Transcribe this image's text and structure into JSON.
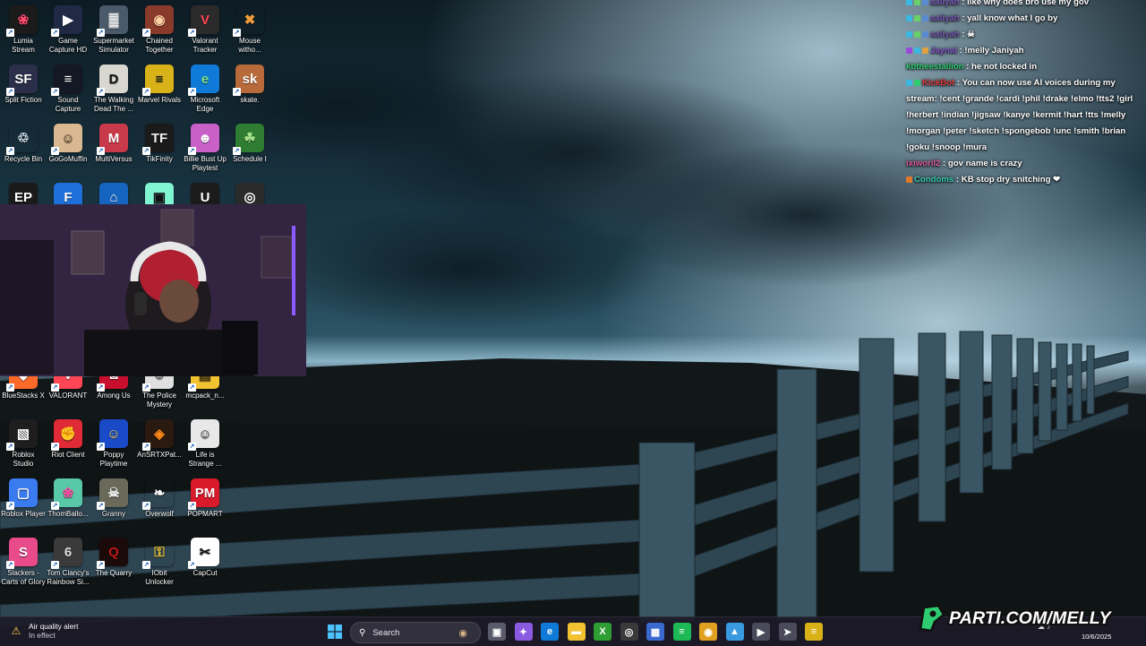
{
  "desktop_icons": [
    {
      "label": "Lumia\nStream",
      "icon": "lumia-icon",
      "color": "#1b1b1b",
      "fg": "#ff4a6e",
      "glyph": "❀"
    },
    {
      "label": "Game\nCapture HD",
      "icon": "game-capture-icon",
      "color": "#202a44",
      "fg": "#ffffff",
      "glyph": "▶"
    },
    {
      "label": "Supermarket\nSimulator",
      "icon": "supermarket-icon",
      "color": "#4a5a6a",
      "fg": "#ffffff",
      "glyph": "▓"
    },
    {
      "label": "Chained\nTogether",
      "icon": "chained-icon",
      "color": "#8a3a2a",
      "fg": "#ffd0a0",
      "glyph": "◉"
    },
    {
      "label": "Valorant\nTracker",
      "icon": "valorant-tracker-icon",
      "color": "#2a2a2a",
      "fg": "#ff4655",
      "glyph": "V"
    },
    {
      "label": "Mouse\nwitho...",
      "icon": "mouse-without-borders-icon",
      "color": "transparent",
      "fg": "#f39c3a",
      "glyph": "✖"
    },
    {
      "label": "Split Fiction",
      "icon": "split-fiction-icon",
      "color": "#2b2f4a",
      "fg": "#ffffff",
      "glyph": "SF"
    },
    {
      "label": "Sound\nCapture",
      "icon": "sound-capture-icon",
      "color": "#141824",
      "fg": "#ffffff",
      "glyph": "≡"
    },
    {
      "label": "The Walking\nDead The ...",
      "icon": "walking-dead-icon",
      "color": "#d8d8d0",
      "fg": "#111111",
      "glyph": "D"
    },
    {
      "label": "Marvel Rivals",
      "icon": "marvel-rivals-icon",
      "color": "#d9b21a",
      "fg": "#1a1a1a",
      "glyph": "≡"
    },
    {
      "label": "Microsoft\nEdge",
      "icon": "edge-icon",
      "color": "#0f7ad8",
      "fg": "#7ee08a",
      "glyph": "e"
    },
    {
      "label": "skate.",
      "icon": "skate-icon",
      "color": "#b96a3a",
      "fg": "#ffffff",
      "glyph": "sk"
    },
    {
      "label": "Recycle Bin",
      "icon": "recycle-bin-icon",
      "color": "transparent",
      "fg": "#d9e6f2",
      "glyph": "♲"
    },
    {
      "label": "GoGoMuffin",
      "icon": "gogomuffin-icon",
      "color": "#d8b890",
      "fg": "#5a3a2a",
      "glyph": "☺"
    },
    {
      "label": "MultiVersus",
      "icon": "multiversus-icon",
      "color": "#c83a4a",
      "fg": "#ffffff",
      "glyph": "M"
    },
    {
      "label": "TikFinity",
      "icon": "tikfinity-icon",
      "color": "#1a1a1a",
      "fg": "#f0f0f0",
      "glyph": "TF"
    },
    {
      "label": "Billie Bust Up\nPlaytest",
      "icon": "billie-bust-up-icon",
      "color": "#c860c8",
      "fg": "#ffffff",
      "glyph": "☻"
    },
    {
      "label": "Schedule I",
      "icon": "schedule-one-icon",
      "color": "#2e7d32",
      "fg": "#a5e08a",
      "glyph": "☘"
    },
    {
      "label": "",
      "icon": "epic-games-icon",
      "color": "#1a1a1a",
      "fg": "#ffffff",
      "glyph": "EP"
    },
    {
      "label": "",
      "icon": "fortnite-icon",
      "color": "#1f6fd8",
      "fg": "#ffffff",
      "glyph": "F"
    },
    {
      "label": "",
      "icon": "app-blue-icon",
      "color": "#1565c0",
      "fg": "#ffffff",
      "glyph": "⌂"
    },
    {
      "label": "",
      "icon": "streamlabs-icon",
      "color": "#80f5d2",
      "fg": "#111111",
      "glyph": "▣"
    },
    {
      "label": "",
      "icon": "unreal-icon",
      "color": "#1b1b1b",
      "fg": "#ffffff",
      "glyph": "U"
    },
    {
      "label": "",
      "icon": "rockstar-icon",
      "color": "#2a2a2a",
      "fg": "#ffffff",
      "glyph": "◎"
    },
    {
      "label": "BlueStacks X",
      "icon": "bluestacks-icon",
      "color": "#ff6a2a",
      "fg": "#ffffff",
      "glyph": "◆"
    },
    {
      "label": "VALORANT",
      "icon": "valorant-icon",
      "color": "#ff4655",
      "fg": "#ffffff",
      "glyph": "V"
    },
    {
      "label": "Among Us",
      "icon": "among-us-icon",
      "color": "#c8102e",
      "fg": "#ffffff",
      "glyph": "◙"
    },
    {
      "label": "The Police\nMystery",
      "icon": "police-mystery-icon",
      "color": "#e0e0e0",
      "fg": "#333333",
      "glyph": "☺"
    },
    {
      "label": "mcpack_n...",
      "icon": "mcpack-icon",
      "color": "#f2c230",
      "fg": "#4a3a10",
      "glyph": "▤"
    },
    {
      "label": "Roblox\nStudio",
      "icon": "roblox-studio-icon",
      "color": "#1e1e1e",
      "fg": "#ffffff",
      "glyph": "▧"
    },
    {
      "label": "Riot Client",
      "icon": "riot-client-icon",
      "color": "#e02b36",
      "fg": "#ffffff",
      "glyph": "✊"
    },
    {
      "label": "Poppy\nPlaytime",
      "icon": "poppy-playtime-icon",
      "color": "#1a4ac8",
      "fg": "#ffdd33",
      "glyph": "☺"
    },
    {
      "label": "AnSRTXPat...",
      "icon": "ansrtx-icon",
      "color": "#2b1a10",
      "fg": "#ff8a1a",
      "glyph": "◈"
    },
    {
      "label": "Life is\nStrange ...",
      "icon": "life-is-strange-icon",
      "color": "#e8e8e8",
      "fg": "#333333",
      "glyph": "☺"
    },
    {
      "label": "Roblox Player",
      "icon": "roblox-player-icon",
      "color": "#3a7bf0",
      "fg": "#ffffff",
      "glyph": "▢"
    },
    {
      "label": "ThomBallo...",
      "icon": "thornballoon-icon",
      "color": "#58c8a8",
      "fg": "#ff4aa0",
      "glyph": "❀"
    },
    {
      "label": "Granny",
      "icon": "granny-icon",
      "color": "#6a6a5a",
      "fg": "#eeeeee",
      "glyph": "☠"
    },
    {
      "label": "Overwolf",
      "icon": "overwolf-icon",
      "color": "transparent",
      "fg": "#ffffff",
      "glyph": "❧"
    },
    {
      "label": "POPMART",
      "icon": "popmart-icon",
      "color": "#d81a2a",
      "fg": "#ffffff",
      "glyph": "PM"
    },
    {
      "label": "Slackers -\nCarts of Glory",
      "icon": "slackers-icon",
      "color": "#e84a8a",
      "fg": "#ffffff",
      "glyph": "S"
    },
    {
      "label": "Tom Clancy's\nRainbow Si...",
      "icon": "rainbow-six-icon",
      "color": "#3a3a3a",
      "fg": "#dddddd",
      "glyph": "6"
    },
    {
      "label": "The Quarry",
      "icon": "the-quarry-icon",
      "color": "#1a0a0a",
      "fg": "#c01818",
      "glyph": "Q"
    },
    {
      "label": "IObit\nUnlocker",
      "icon": "iobit-unlocker-icon",
      "color": "transparent",
      "fg": "#f2c230",
      "glyph": "⚿"
    },
    {
      "label": "CapCut",
      "icon": "capcut-icon",
      "color": "#ffffff",
      "fg": "#111111",
      "glyph": "✂"
    }
  ],
  "chat": [
    {
      "user": "aaliyah",
      "user_color": "#7a5ab8",
      "text": ": like why does bro use my gov",
      "badges": [
        "#3ab8e0",
        "#6ad06a",
        "#5a8ad0"
      ]
    },
    {
      "user": "aaliyah",
      "user_color": "#7a5ab8",
      "text": ": yall know what I go by",
      "badges": [
        "#3ab8e0",
        "#6ad06a",
        "#5a8ad0"
      ]
    },
    {
      "user": "aaliyah",
      "user_color": "#7a5ab8",
      "text": ": ☠",
      "badges": [
        "#3ab8e0",
        "#6ad06a",
        "#5a8ad0"
      ]
    },
    {
      "user": "Jaynai",
      "user_color": "#8a5ad0",
      "text": ": !melly Janiyah",
      "badges": [
        "#9a4ad8",
        "#3ab8e0",
        "#e0a040"
      ]
    },
    {
      "user": "kbtheestallion",
      "user_color": "#2ecc71",
      "text": ": he not locked in",
      "badges": []
    },
    {
      "user": "KickBot",
      "user_color": "#e03a3a",
      "text": ": You can now use AI voices during my stream: !cent !grande !cardi !phil !drake !elmo !tts2 !girl !herbert !indian !jigsaw !kanye !kermit !hart !tts !melly !morgan !peter !sketch !spongebob !unc !smith !brian !goku !snoop !mura",
      "badges": [
        "#3ab8e0",
        "#2ecc71"
      ]
    },
    {
      "user": "ixiworil2",
      "user_color": "#e05aa0",
      "text": ": gov name is crazy",
      "badges": []
    },
    {
      "user": "Condoms",
      "user_color": "#3ad0b8",
      "text": ": KB stop dry snitching ❤",
      "badges": [
        "#e07a2a"
      ]
    }
  ],
  "taskbar": {
    "weather_title": "Air quality alert",
    "weather_sub": "In effect",
    "search_placeholder": "Search",
    "date": "10/6/2025",
    "pinned": [
      {
        "icon": "task-view-icon",
        "color": "#5a5a6a",
        "glyph": "▣"
      },
      {
        "icon": "copilot-icon",
        "color": "#8a5ae0",
        "glyph": "✦"
      },
      {
        "icon": "edge-taskbar-icon",
        "color": "#0f7ad8",
        "glyph": "e"
      },
      {
        "icon": "file-explorer-icon",
        "color": "#f2c230",
        "glyph": "▬"
      },
      {
        "icon": "xbox-icon",
        "color": "#2e9d32",
        "glyph": "X"
      },
      {
        "icon": "obs-icon",
        "color": "#3a3a3a",
        "glyph": "◎"
      },
      {
        "icon": "store-icon",
        "color": "#3a6ad0",
        "glyph": "▦"
      },
      {
        "icon": "spotify-icon",
        "color": "#1db954",
        "glyph": "≡"
      },
      {
        "icon": "chrome-icon",
        "color": "#e0a020",
        "glyph": "◉"
      },
      {
        "icon": "photos-icon",
        "color": "#3a9ae0",
        "glyph": "▲"
      },
      {
        "icon": "media-player-icon",
        "color": "#4a4a5a",
        "glyph": "▶"
      },
      {
        "icon": "arrow-app-icon",
        "color": "#4a4a5a",
        "glyph": "➤"
      },
      {
        "icon": "marvel-rivals-taskbar-icon",
        "color": "#d9b21a",
        "glyph": "≡"
      }
    ]
  },
  "overlay": {
    "text": "PARTI.COM/MELLY",
    "logo": "parti-logo-icon",
    "color": "#2ecc71"
  }
}
